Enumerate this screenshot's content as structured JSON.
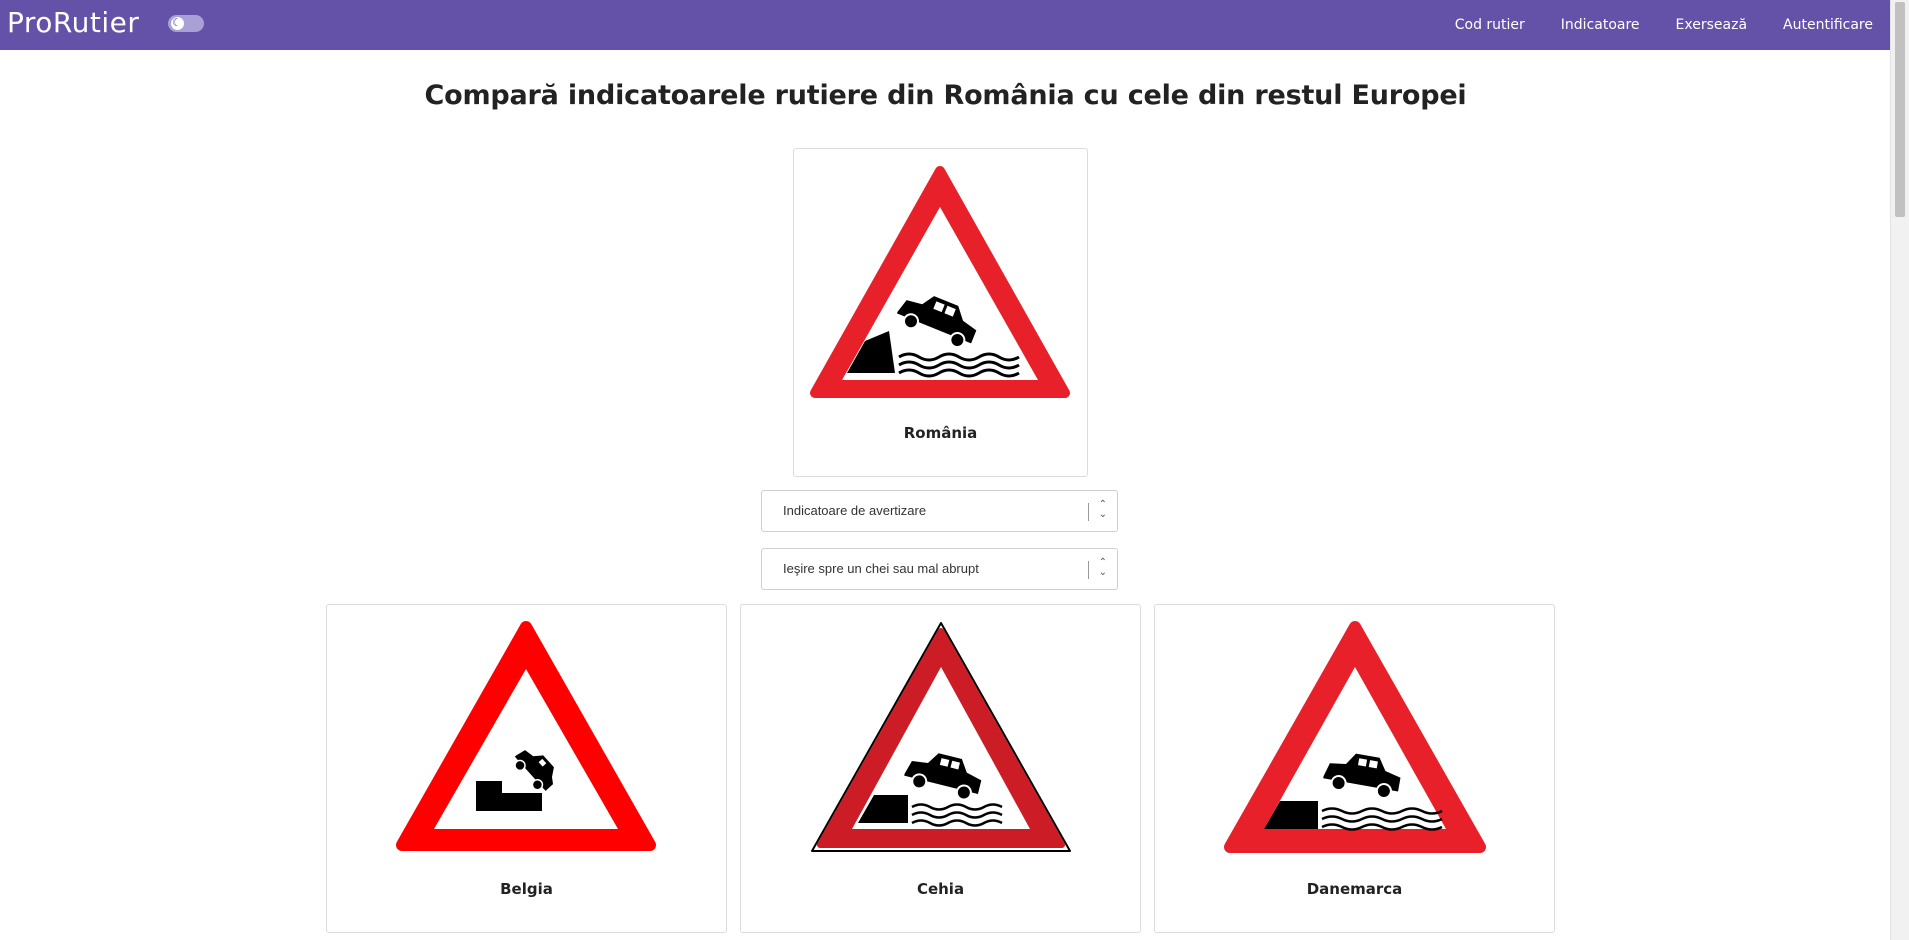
{
  "header": {
    "brand": "ProRutier",
    "nav": [
      "Cod rutier",
      "Indicatoare",
      "Exersează",
      "Autentificare"
    ]
  },
  "page_title": "Compară indicatoarele rutiere din România cu cele din restul Europei",
  "main_sign": {
    "country": "România"
  },
  "filters": {
    "category": "Indicatoare de avertizare",
    "sign": "Ieşire spre un chei sau mal abrupt"
  },
  "compare_signs": [
    {
      "country": "Belgia"
    },
    {
      "country": "Cehia"
    },
    {
      "country": "Danemarca"
    }
  ],
  "colors": {
    "navbar": "#6352a7",
    "sign_red": "#e8202a",
    "belgium_red": "#ff0000",
    "czech_red": "#cc1c25"
  }
}
